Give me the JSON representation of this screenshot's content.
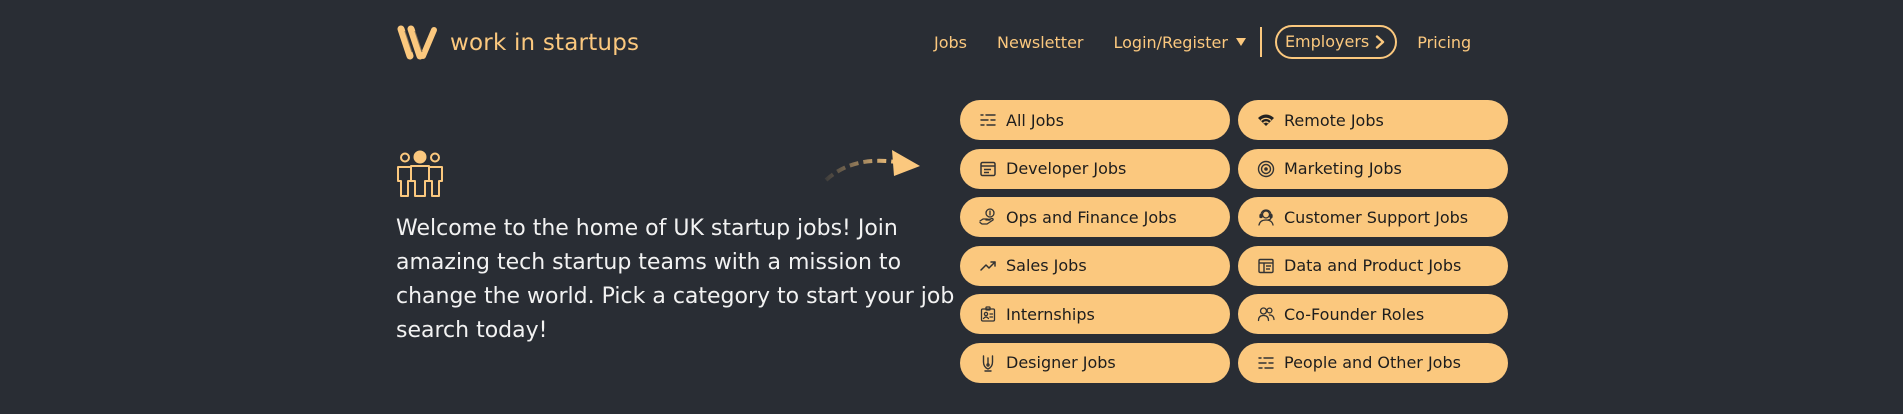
{
  "header": {
    "logo_text": "work in startups",
    "nav": {
      "jobs": "Jobs",
      "newsletter": "Newsletter",
      "login": "Login/Register",
      "employers": "Employers",
      "pricing": "Pricing"
    }
  },
  "hero": {
    "text": "Welcome to the home of UK startup jobs! Join amazing tech startup teams with a mission to change the world. Pick a category to start your job search today!"
  },
  "categories": [
    {
      "label": "All Jobs",
      "icon": "sliders-icon"
    },
    {
      "label": "Remote Jobs",
      "icon": "wifi-icon"
    },
    {
      "label": "Developer Jobs",
      "icon": "browser-window-icon"
    },
    {
      "label": "Marketing Jobs",
      "icon": "target-icon"
    },
    {
      "label": "Ops and Finance Jobs",
      "icon": "hand-coin-icon"
    },
    {
      "label": "Customer Support Jobs",
      "icon": "headset-agent-icon"
    },
    {
      "label": "Sales Jobs",
      "icon": "trending-up-icon"
    },
    {
      "label": "Data and Product Jobs",
      "icon": "dashboard-icon"
    },
    {
      "label": "Internships",
      "icon": "id-badge-icon"
    },
    {
      "label": "Co-Founder Roles",
      "icon": "users-icon"
    },
    {
      "label": "Designer Jobs",
      "icon": "pen-nib-icon"
    },
    {
      "label": "People and Other Jobs",
      "icon": "sliders-icon"
    }
  ],
  "colors": {
    "background": "#292d34",
    "accent": "#fbc87e",
    "hero_text": "#f2f2f2",
    "button_text": "#1d1d1d"
  }
}
